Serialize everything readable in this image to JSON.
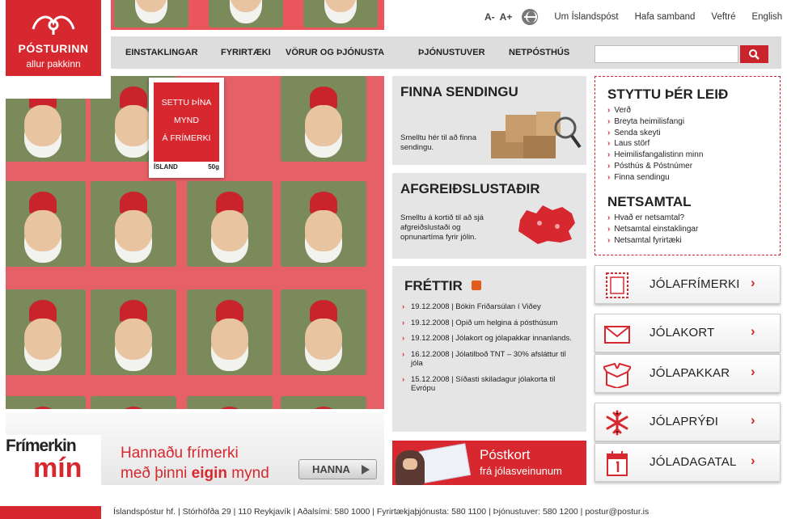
{
  "logo": {
    "brand": "PÓSTURINN",
    "tagline": "allur pakkinn"
  },
  "top_links": {
    "font_smaller": "A-",
    "font_larger": "A+",
    "items": [
      "Um Íslandspóst",
      "Hafa samband",
      "Veftré",
      "English"
    ]
  },
  "nav": {
    "items": [
      "EINSTAKLINGAR",
      "FYRIRTÆKI",
      "VÖRUR OG ÞJÓNUSTA",
      "ÞJÓNUSTUVER",
      "NETPÓSTHÚS"
    ]
  },
  "search": {
    "value": ""
  },
  "hero_stamp": {
    "lines": [
      "SETTU ÞÍNA",
      "MYND",
      "Á FRÍMERKI"
    ],
    "country": "ÍSLAND",
    "value": "50g"
  },
  "frimerkin": {
    "logo_a": "Frímerkin",
    "logo_b": "mín",
    "line1": "Hannaðu frímerki",
    "line2_pre": "með þinni ",
    "line2_bold": "eigin",
    "line2_post": " mynd",
    "button": "HANNA"
  },
  "finna": {
    "title": "FINNA SENDINGU",
    "text": "Smelltu hér til að finna sendingu."
  },
  "afgreidsla": {
    "title": "AFGREIÐSLUSTAÐIR",
    "text": "Smelltu á kortið til að sjá afgreiðslustaði og opnunartíma fyrir jólin."
  },
  "frettir": {
    "title": "FRÉTTIR",
    "items": [
      "19.12.2008 | Bókin Friðarsúlan í Viðey",
      "19.12.2008 | Opið um helgina á pósthúsum",
      "19.12.2008 | Jólakort og jólapakkar innanlands.",
      "16.12.2008 | Jólatilboð TNT – 30% afsláttur til jóla",
      "15.12.2008 | Síðasti skiladagur jólakorta til Evrópu"
    ]
  },
  "postkort": {
    "title": "Póstkort",
    "subtitle": "frá jólasveinunum"
  },
  "styttu": {
    "title": "STYTTU ÞÉR LEIÐ",
    "items": [
      "Verð",
      "Breyta heimilisfangi",
      "Senda skeyti",
      "Laus störf",
      "Heimilisfangalistinn minn",
      "Pósthús & Póstnúmer",
      "Finna sendingu"
    ],
    "title2": "NETSAMTAL",
    "items2": [
      "Hvað er netsamtal?",
      "Netsamtal einstaklingar",
      "Netsamtal fyrirtæki"
    ]
  },
  "promos": [
    {
      "label": "JÓLAFRÍMERKI",
      "icon": "stamp-icon"
    },
    {
      "label": "JÓLAKORT",
      "icon": "envelope-icon"
    },
    {
      "label": "JÓLAPAKKAR",
      "icon": "gift-box-icon"
    },
    {
      "label": "JÓLAPRÝÐI",
      "icon": "snowflake-icon"
    },
    {
      "label": "JÓLADAGATAL",
      "icon": "calendar-icon"
    }
  ],
  "footer": {
    "text": "Íslandspóstur hf. | Stórhöfða 29 | 110 Reykjavík | Aðalsími: 580 1000 | Fyrirtækjaþjónusta: 580 1100 | Þjónustuver: 580 1200 | postur@postur.is"
  },
  "colors": {
    "brand_red": "#d7282f",
    "panel_gray": "#e5e5e5"
  }
}
